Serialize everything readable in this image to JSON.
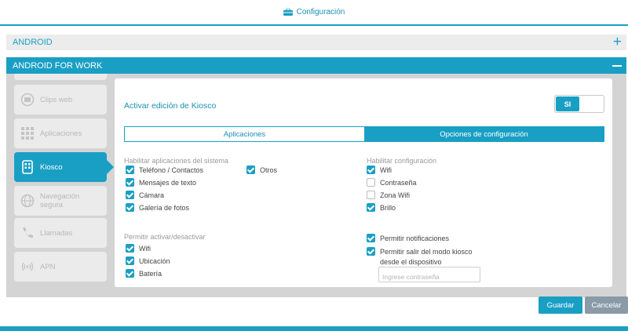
{
  "header": {
    "title": "Configuración",
    "icon": "briefcase-icon"
  },
  "sections": {
    "android": {
      "label": "ANDROID",
      "icon": "plus-icon"
    },
    "afw": {
      "label": "ANDROID FOR WORK",
      "icon": "minus-icon"
    }
  },
  "sidebar": {
    "items": [
      {
        "label": "Clips web",
        "icon": "clips-web-icon"
      },
      {
        "label": "Aplicaciones",
        "icon": "apps-grid-icon"
      },
      {
        "label": "Kiosco",
        "icon": "kiosk-icon",
        "active": true
      },
      {
        "label": "Navegación segura",
        "icon": "globe-icon"
      },
      {
        "label": "Llamadas",
        "icon": "phone-icon"
      },
      {
        "label": "APN",
        "icon": "apn-icon"
      }
    ]
  },
  "content": {
    "kiosk_title": "Activar edición de Kiosco",
    "toggle_label": "SI",
    "tabs": [
      {
        "label": "Aplicaciones",
        "active": false
      },
      {
        "label": "Opciones de configuración",
        "active": true
      }
    ],
    "system_apps": {
      "label": "Habilitar aplicaciones del sistema",
      "items": [
        {
          "label": "Teléfono / Contactos",
          "checked": true
        },
        {
          "label": "Mensajes de texto",
          "checked": true
        },
        {
          "label": "Cámara",
          "checked": true
        },
        {
          "label": "Galería de fotos",
          "checked": true
        },
        {
          "label": "Otros",
          "checked": true
        }
      ]
    },
    "config": {
      "label": "Habilitar configuración",
      "items": [
        {
          "label": "Wifi",
          "checked": true
        },
        {
          "label": "Contraseña",
          "checked": false
        },
        {
          "label": "Zona Wifi",
          "checked": false
        },
        {
          "label": "Brillo",
          "checked": true
        }
      ]
    },
    "toggle_group": {
      "label": "Permitir activar/desactivar",
      "items": [
        {
          "label": "Wifi",
          "checked": true
        },
        {
          "label": "Ubicación",
          "checked": true
        },
        {
          "label": "Batería",
          "checked": true
        }
      ]
    },
    "permissions": {
      "items": [
        {
          "label": "Permitir notificaciones",
          "checked": true
        },
        {
          "label": "Permitir salir del modo kiosco",
          "label2": "desde el dispositivo",
          "checked": true
        }
      ],
      "password_placeholder": "Ingrese contraseña"
    }
  },
  "buttons": {
    "save": "Guardar",
    "cancel": "Cancelar"
  },
  "colors": {
    "accent": "#1a9fc4",
    "panel": "#d4d4d4",
    "cancel": "#8a9aa6"
  }
}
